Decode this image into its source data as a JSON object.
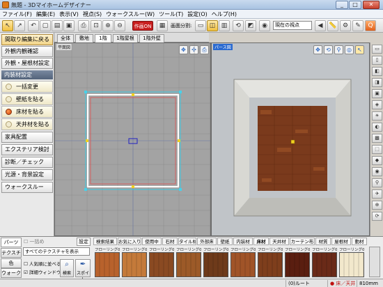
{
  "window": {
    "title": "無題 - 3Dマイホームデザイナー",
    "min": "_",
    "max": "□",
    "close": "✕"
  },
  "menu": [
    "ファイル(F)",
    "編集(E)",
    "表示(V)",
    "視点(S)",
    "ウォークスルー(W)",
    "ツール(T)",
    "設定(O)",
    "ヘルプ(H)"
  ],
  "toolbar": {
    "badge": "作画ON",
    "screen_split_label": "画面分割:",
    "viewpoint_value": "現在の視点"
  },
  "left": {
    "back_button": "間取り編集に戻る",
    "exterior_check": "外観内観確認",
    "exterior_material": "外観・屋根材設定",
    "interior_header": "内装材設定",
    "interior_items": [
      {
        "label": "一括変更",
        "active": false
      },
      {
        "label": "壁紙を貼る",
        "active": false
      },
      {
        "label": "床材を貼る",
        "active": true
      },
      {
        "label": "天井材を貼る",
        "active": false
      }
    ],
    "menu_items": [
      "家具配置",
      "エクステリア検討",
      "診断／チェック",
      "光源・背景設定",
      "ウォークスルー"
    ]
  },
  "floor_tabs": [
    "全体",
    "敷地",
    "1階",
    "1階屋根",
    "1階外壁"
  ],
  "floor_tab_active": 2,
  "plan_view": {
    "label": "平面図"
  },
  "persp_view": {
    "label": "パース図"
  },
  "bottom": {
    "side_tabs": [
      "パーツ",
      "テクスチャ",
      "色",
      "ウォーク"
    ],
    "search_label": "一括め",
    "settings_label": "設定",
    "texture_filter": "すべてのテクスチャを表示",
    "popular_label": "人気順に並べる",
    "detail_window_label": "詳細ウィンドウ",
    "search_button": "検索",
    "dropper_button": "スポイト",
    "category_tabs": [
      "検索結果",
      "お気に入り",
      "使用中",
      "石材",
      "タイル材",
      "外部床",
      "壁紙",
      "内装材",
      "床材",
      "天井材",
      "カーテン布",
      "材質",
      "屋根材",
      "動材"
    ],
    "category_active": 8,
    "swatches": [
      {
        "label": "フローリング005",
        "color": "#b8622c"
      },
      {
        "label": "フローリング006",
        "color": "#c47a3a"
      },
      {
        "label": "フローリング007",
        "color": "#8a4a22"
      },
      {
        "label": "フローリング008",
        "color": "#9c5a28"
      },
      {
        "label": "フローリング009",
        "color": "#6e3a1a"
      },
      {
        "label": "フローリング010",
        "color": "#a05428"
      },
      {
        "label": "フローリング011",
        "color": "#7e3e1c"
      },
      {
        "label": "フローリング012",
        "color": "#5a1e10"
      },
      {
        "label": "フローリング013",
        "color": "#6a2a18"
      },
      {
        "label": "フローリング001",
        "color": "#f2e8cc"
      }
    ]
  },
  "status": {
    "route": "(0)ルート",
    "floor_ceiling": "床／天井",
    "dimension": "810mm"
  }
}
